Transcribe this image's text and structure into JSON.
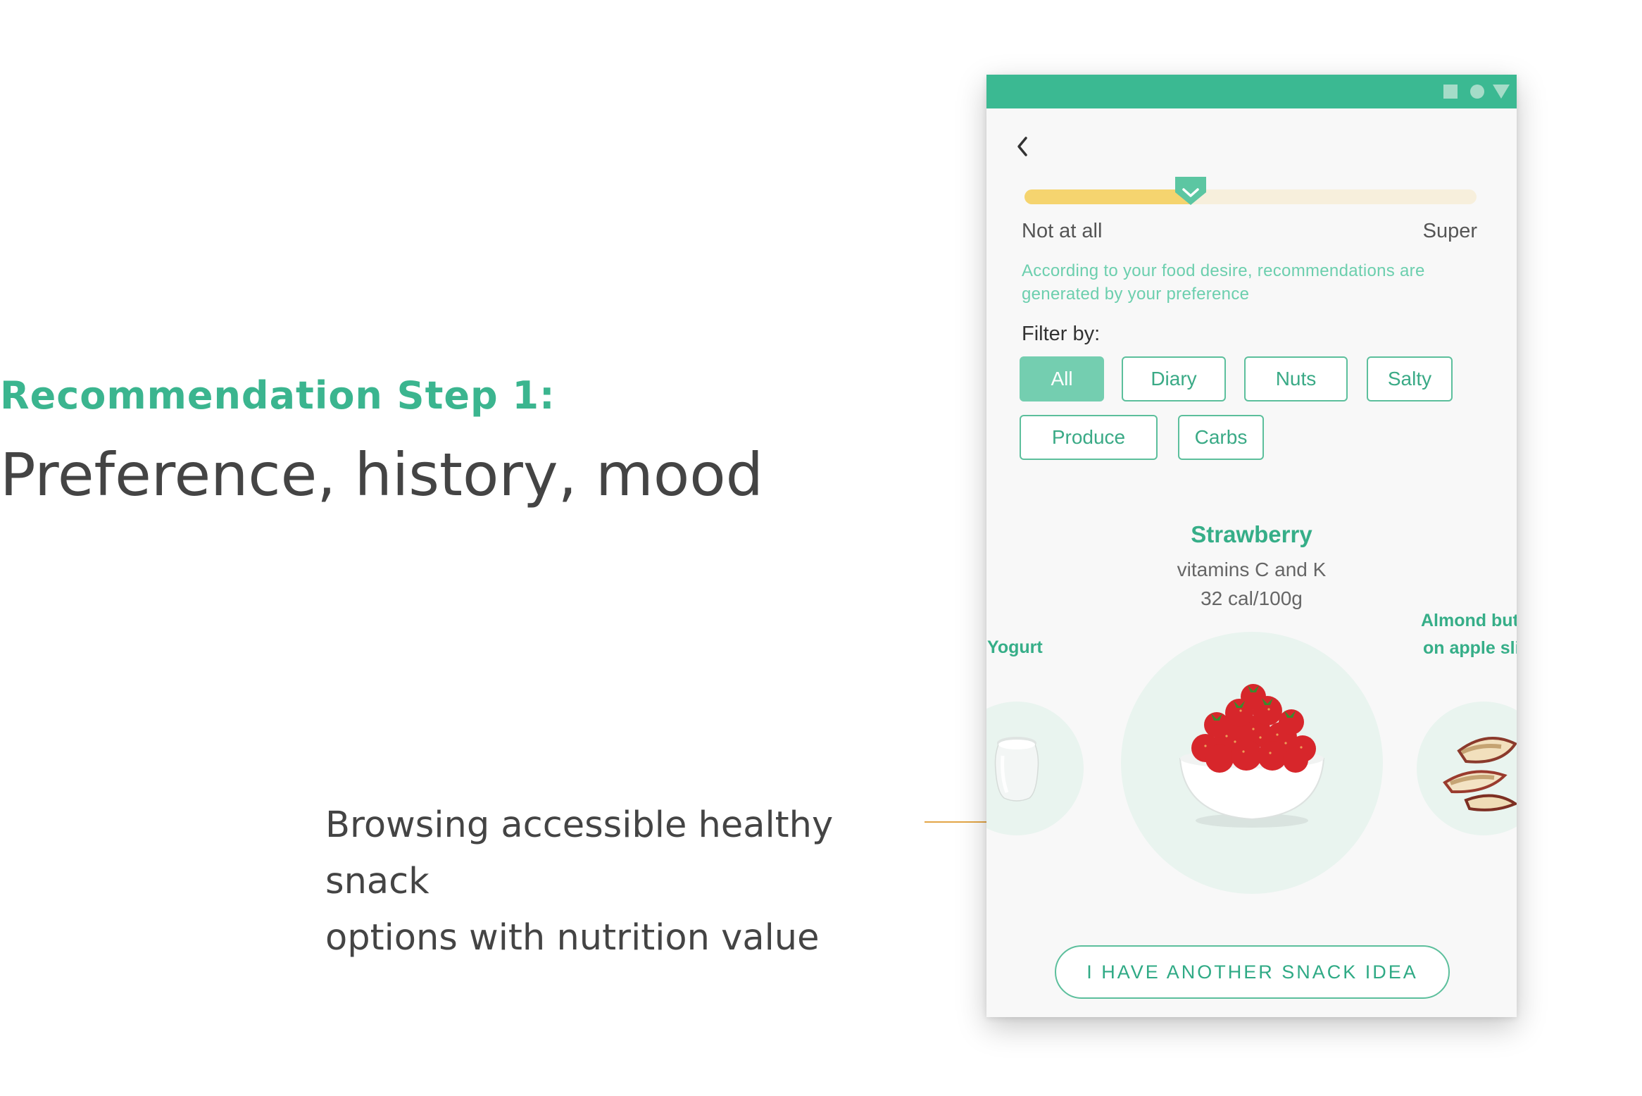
{
  "slide": {
    "step_label": "Recommendation Step 1:",
    "title": "Preference, history, mood",
    "caption_line1": "Browsing accessible healthy snack",
    "caption_line2": "options with nutrition value"
  },
  "phone": {
    "status_icons": [
      "square-icon",
      "circle-icon",
      "triangle-icon"
    ],
    "slider": {
      "min_label": "Not at all",
      "max_label": "Super",
      "value_fraction": 0.38
    },
    "note": "According to your food desire, recommendations are generated by your preference",
    "filter": {
      "label": "Filter by:",
      "chips": [
        "All",
        "Diary",
        "Nuts",
        "Salty",
        "Produce",
        "Carbs"
      ],
      "selected": "All"
    },
    "carousel": {
      "current": {
        "name": "Strawberry",
        "nutrients": "vitamins C and K",
        "calories": "32 cal/100g"
      },
      "prev": {
        "name": "Yogurt"
      },
      "next": {
        "name_line1": "Almond butter",
        "name_line2": "on apple slices"
      }
    },
    "cta_label": "I HAVE ANOTHER SNACK IDEA"
  },
  "colors": {
    "brand_green": "#3bb992",
    "accent_text": "#3bb58f",
    "slider_fill": "#f5d46f",
    "caption_rule": "#e3a646"
  }
}
